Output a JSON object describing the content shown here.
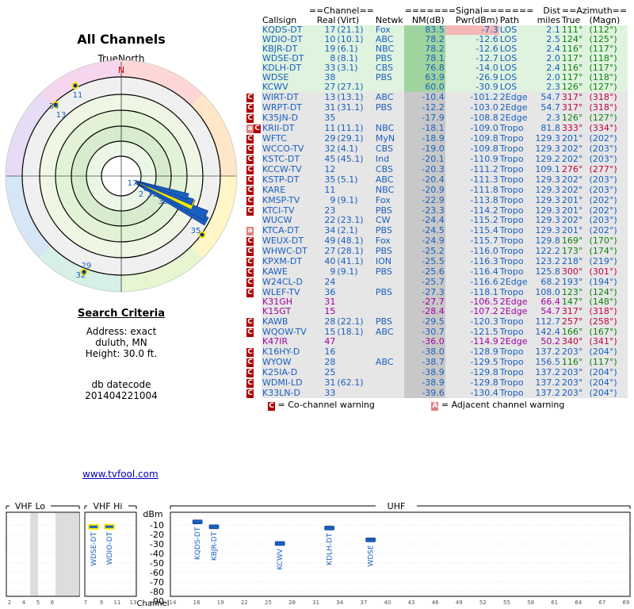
{
  "left": {
    "title": "All Channels",
    "truenorth": "TrueNorth",
    "north": "N",
    "plot_labels": [
      "11",
      "34",
      "13",
      "17",
      "8",
      "2",
      "33",
      "38",
      "35",
      "29",
      "32"
    ]
  },
  "criteria": {
    "heading": "Search Criteria",
    "address": "Address: exact",
    "city": "duluth, MN",
    "height": "Height: 30.0 ft."
  },
  "datecode": {
    "label": "db datecode",
    "value": "201404221004"
  },
  "link": "www.tvfool.com",
  "table": {
    "group_headers": {
      "channel": "==Channel==",
      "signal": "=======Signal=======",
      "dist": "Dist",
      "azimuth": "==Azimuth=="
    },
    "headers": [
      "Callsign",
      "Real",
      "(Virt)",
      "Netwk",
      "NM(dB)",
      "Pwr(dBm)",
      "Path",
      "miles",
      "True",
      "(Magn)"
    ],
    "rows": [
      {
        "w": "",
        "call": "KQDS-DT",
        "real": "17",
        "virt": "(21.1)",
        "net": "Fox",
        "nm": "83.5",
        "pwr": "-7.3",
        "path": "LOS",
        "dist": "2.1",
        "tru": "111°",
        "mag": "(112°)",
        "cls": "good",
        "pr": true
      },
      {
        "w": "",
        "call": "WDIO-DT",
        "real": "10",
        "virt": "(10.1)",
        "net": "ABC",
        "nm": "78.2",
        "pwr": "-12.6",
        "path": "LOS",
        "dist": "2.5",
        "tru": "124°",
        "mag": "(125°)",
        "cls": "good"
      },
      {
        "w": "",
        "call": "KBJR-DT",
        "real": "19",
        "virt": "(6.1)",
        "net": "NBC",
        "nm": "78.2",
        "pwr": "-12.6",
        "path": "LOS",
        "dist": "2.4",
        "tru": "116°",
        "mag": "(117°)",
        "cls": "good"
      },
      {
        "w": "",
        "call": "WDSE-DT",
        "real": "8",
        "virt": "(8.1)",
        "net": "PBS",
        "nm": "78.1",
        "pwr": "-12.7",
        "path": "LOS",
        "dist": "2.0",
        "tru": "117°",
        "mag": "(118°)",
        "cls": "good"
      },
      {
        "w": "",
        "call": "KDLH-DT",
        "real": "33",
        "virt": "(3.1)",
        "net": "CBS",
        "nm": "76.8",
        "pwr": "-14.0",
        "path": "LOS",
        "dist": "2.4",
        "tru": "116°",
        "mag": "(117°)",
        "cls": "good"
      },
      {
        "w": "",
        "call": "WDSE",
        "real": "38",
        "virt": "",
        "net": "PBS",
        "nm": "63.9",
        "pwr": "-26.9",
        "path": "LOS",
        "dist": "2.0",
        "tru": "117°",
        "mag": "(118°)",
        "cls": "good"
      },
      {
        "w": "",
        "call": "KCWV",
        "real": "27",
        "virt": "(27.1)",
        "net": "",
        "nm": "60.0",
        "pwr": "-30.9",
        "path": "LOS",
        "dist": "2.3",
        "tru": "126°",
        "mag": "(127°)",
        "cls": "good"
      },
      {
        "w": "C",
        "call": "WIRT-DT",
        "real": "13",
        "virt": "(13.1)",
        "net": "ABC",
        "nm": "-10.4",
        "pwr": "-101.2",
        "path": "2Edge",
        "dist": "54.7",
        "tru": "317°",
        "mag": "(318°)",
        "cls": "gray",
        "az": "red"
      },
      {
        "w": "C",
        "call": "WRPT-DT",
        "real": "31",
        "virt": "(31.1)",
        "net": "PBS",
        "nm": "-12.2",
        "pwr": "-103.0",
        "path": "2Edge",
        "dist": "54.7",
        "tru": "317°",
        "mag": "(318°)",
        "cls": "gray",
        "az": "red"
      },
      {
        "w": "C",
        "call": "K35JN-D",
        "real": "35",
        "virt": "",
        "net": "",
        "nm": "-17.9",
        "pwr": "-108.8",
        "path": "2Edge",
        "dist": "2.3",
        "tru": "126°",
        "mag": "(127°)",
        "cls": "gray",
        "az": "green"
      },
      {
        "w": "CA",
        "call": "KRII-DT",
        "real": "11",
        "virt": "(11.1)",
        "net": "NBC",
        "nm": "-18.1",
        "pwr": "-109.0",
        "path": "Tropo",
        "dist": "81.8",
        "tru": "333°",
        "mag": "(334°)",
        "cls": "gray",
        "az": "red"
      },
      {
        "w": "C",
        "call": "WFTC",
        "real": "29",
        "virt": "(29.1)",
        "net": "MyN",
        "nm": "-18.9",
        "pwr": "-109.8",
        "path": "Tropo",
        "dist": "129.3",
        "tru": "201°",
        "mag": "(202°)",
        "cls": "gray",
        "az": "blue"
      },
      {
        "w": "C",
        "call": "WCCO-TV",
        "real": "32",
        "virt": "(4.1)",
        "net": "CBS",
        "nm": "-19.0",
        "pwr": "-109.8",
        "path": "Tropo",
        "dist": "129.3",
        "tru": "202°",
        "mag": "(203°)",
        "cls": "gray",
        "az": "blue"
      },
      {
        "w": "C",
        "call": "KSTC-DT",
        "real": "45",
        "virt": "(45.1)",
        "net": "Ind",
        "nm": "-20.1",
        "pwr": "-110.9",
        "path": "Tropo",
        "dist": "129.2",
        "tru": "202°",
        "mag": "(203°)",
        "cls": "gray",
        "az": "blue"
      },
      {
        "w": "C",
        "call": "KCCW-TV",
        "real": "12",
        "virt": "",
        "net": "CBS",
        "nm": "-20.3",
        "pwr": "-111.2",
        "path": "Tropo",
        "dist": "109.1",
        "tru": "276°",
        "mag": "(277°)",
        "cls": "gray",
        "az": "red"
      },
      {
        "w": "C",
        "call": "KSTP-DT",
        "real": "35",
        "virt": "(5.1)",
        "net": "ABC",
        "nm": "-20.4",
        "pwr": "-111.3",
        "path": "Tropo",
        "dist": "129.3",
        "tru": "202°",
        "mag": "(203°)",
        "cls": "gray",
        "az": "blue"
      },
      {
        "w": "C",
        "call": "KARE",
        "real": "11",
        "virt": "",
        "net": "NBC",
        "nm": "-20.9",
        "pwr": "-111.8",
        "path": "Tropo",
        "dist": "129.3",
        "tru": "202°",
        "mag": "(203°)",
        "cls": "gray",
        "az": "blue"
      },
      {
        "w": "C",
        "call": "KMSP-TV",
        "real": "9",
        "virt": "(9.1)",
        "net": "Fox",
        "nm": "-22.9",
        "pwr": "-113.8",
        "path": "Tropo",
        "dist": "129.3",
        "tru": "201°",
        "mag": "(202°)",
        "cls": "gray",
        "az": "blue"
      },
      {
        "w": "C",
        "call": "KTCI-TV",
        "real": "23",
        "virt": "",
        "net": "PBS",
        "nm": "-23.3",
        "pwr": "-114.2",
        "path": "Tropo",
        "dist": "129.3",
        "tru": "201°",
        "mag": "(202°)",
        "cls": "gray",
        "az": "blue"
      },
      {
        "w": "",
        "call": "WUCW",
        "real": "22",
        "virt": "(23.1)",
        "net": "CW",
        "nm": "-24.4",
        "pwr": "-115.2",
        "path": "Tropo",
        "dist": "129.3",
        "tru": "202°",
        "mag": "(203°)",
        "cls": "gray",
        "az": "blue"
      },
      {
        "w": "A",
        "call": "KTCA-DT",
        "real": "34",
        "virt": "(2.1)",
        "net": "PBS",
        "nm": "-24.5",
        "pwr": "-115.4",
        "path": "Tropo",
        "dist": "129.3",
        "tru": "201°",
        "mag": "(202°)",
        "cls": "gray",
        "az": "blue"
      },
      {
        "w": "C",
        "call": "WEUX-DT",
        "real": "49",
        "virt": "(48.1)",
        "net": "Fox",
        "nm": "-24.9",
        "pwr": "-115.7",
        "path": "Tropo",
        "dist": "129.8",
        "tru": "169°",
        "mag": "(170°)",
        "cls": "gray",
        "az": "green"
      },
      {
        "w": "C",
        "call": "WHWC-DT",
        "real": "27",
        "virt": "(28.1)",
        "net": "PBS",
        "nm": "-25.2",
        "pwr": "-116.0",
        "path": "Tropo",
        "dist": "122.2",
        "tru": "173°",
        "mag": "(174°)",
        "cls": "gray",
        "az": "green"
      },
      {
        "w": "C",
        "call": "KPXM-DT",
        "real": "40",
        "virt": "(41.1)",
        "net": "ION",
        "nm": "-25.5",
        "pwr": "-116.3",
        "path": "Tropo",
        "dist": "123.2",
        "tru": "218°",
        "mag": "(219°)",
        "cls": "gray",
        "az": "blue"
      },
      {
        "w": "C",
        "call": "KAWE",
        "real": "9",
        "virt": "(9.1)",
        "net": "PBS",
        "nm": "-25.6",
        "pwr": "-116.4",
        "path": "Tropo",
        "dist": "125.8",
        "tru": "300°",
        "mag": "(301°)",
        "cls": "gray",
        "az": "red"
      },
      {
        "w": "C",
        "call": "W24CL-D",
        "real": "24",
        "virt": "",
        "net": "",
        "nm": "-25.7",
        "pwr": "-116.6",
        "path": "2Edge",
        "dist": "68.2",
        "tru": "193°",
        "mag": "(194°)",
        "cls": "gray",
        "az": "blue"
      },
      {
        "w": "C",
        "call": "WLEF-TV",
        "real": "36",
        "virt": "",
        "net": "PBS",
        "nm": "-27.3",
        "pwr": "-118.1",
        "path": "Tropo",
        "dist": "108.0",
        "tru": "123°",
        "mag": "(124°)",
        "cls": "gray",
        "az": "green"
      },
      {
        "w": "",
        "call": "K31GH",
        "real": "31",
        "virt": "",
        "net": "",
        "nm": "-27.7",
        "pwr": "-106.5",
        "path": "2Edge",
        "dist": "66.4",
        "tru": "147°",
        "mag": "(148°)",
        "cls": "gray",
        "az": "green",
        "purple": true
      },
      {
        "w": "",
        "call": "K15GT",
        "real": "15",
        "virt": "",
        "net": "",
        "nm": "-28.4",
        "pwr": "-107.2",
        "path": "2Edge",
        "dist": "54.7",
        "tru": "317°",
        "mag": "(318°)",
        "cls": "gray",
        "az": "red",
        "purple": true
      },
      {
        "w": "C",
        "call": "KAWB",
        "real": "28",
        "virt": "(22.1)",
        "net": "PBS",
        "nm": "-29.5",
        "pwr": "-120.3",
        "path": "Tropo",
        "dist": "112.7",
        "tru": "257°",
        "mag": "(258°)",
        "cls": "gray",
        "az": "red"
      },
      {
        "w": "C",
        "call": "WQOW-TV",
        "real": "15",
        "virt": "(18.1)",
        "net": "ABC",
        "nm": "-30.7",
        "pwr": "-121.5",
        "path": "Tropo",
        "dist": "142.4",
        "tru": "166°",
        "mag": "(167°)",
        "cls": "gray",
        "az": "green"
      },
      {
        "w": "",
        "call": "K47IR",
        "real": "47",
        "virt": "",
        "net": "",
        "nm": "-36.0",
        "pwr": "-114.9",
        "path": "2Edge",
        "dist": "50.2",
        "tru": "340°",
        "mag": "(341°)",
        "cls": "gray",
        "az": "red",
        "purple": true
      },
      {
        "w": "C",
        "call": "K16HY-D",
        "real": "16",
        "virt": "",
        "net": "",
        "nm": "-38.0",
        "pwr": "-128.9",
        "path": "Tropo",
        "dist": "137.2",
        "tru": "203°",
        "mag": "(204°)",
        "cls": "gray",
        "az": "blue"
      },
      {
        "w": "C",
        "call": "WYOW",
        "real": "28",
        "virt": "",
        "net": "ABC",
        "nm": "-38.7",
        "pwr": "-129.5",
        "path": "Tropo",
        "dist": "156.5",
        "tru": "116°",
        "mag": "(117°)",
        "cls": "gray",
        "az": "green"
      },
      {
        "w": "C",
        "call": "K25IA-D",
        "real": "25",
        "virt": "",
        "net": "",
        "nm": "-38.9",
        "pwr": "-129.8",
        "path": "Tropo",
        "dist": "137.2",
        "tru": "203°",
        "mag": "(204°)",
        "cls": "gray",
        "az": "blue"
      },
      {
        "w": "C",
        "call": "WDMI-LD",
        "real": "31",
        "virt": "(62.1)",
        "net": "",
        "nm": "-38.9",
        "pwr": "-129.8",
        "path": "Tropo",
        "dist": "137.2",
        "tru": "203°",
        "mag": "(204°)",
        "cls": "gray",
        "az": "blue"
      },
      {
        "w": "C",
        "call": "K33LN-D",
        "real": "33",
        "virt": "",
        "net": "",
        "nm": "-39.6",
        "pwr": "-130.4",
        "path": "Tropo",
        "dist": "137.2",
        "tru": "203°",
        "mag": "(204°)",
        "cls": "gray",
        "az": "blue"
      }
    ],
    "legend_co": "= Co-channel warning",
    "legend_adj": "= Adjacent channel warning",
    "co_mark": "C",
    "adj_mark": "A"
  },
  "spectrum": {
    "sections": {
      "vhf_lo": "VHF Lo",
      "vhf_hi": "VHF Hi",
      "dbm": "dBm",
      "uhf": "UHF"
    },
    "y_ticks": [
      "-10",
      "-20",
      "-30",
      "-40",
      "-50",
      "-60",
      "-70",
      "-80",
      "-90"
    ],
    "channel_label": "Channel",
    "lo_ticks": [
      "2",
      "4",
      "5",
      "6"
    ],
    "hi_ticks": [
      "7",
      "9",
      "11",
      "13"
    ],
    "uhf_ticks": [
      "14",
      "16",
      "19",
      "22",
      "25",
      "28",
      "31",
      "34",
      "37",
      "40",
      "43",
      "46",
      "49",
      "52",
      "55",
      "58",
      "61",
      "64",
      "67",
      "69"
    ],
    "stations": [
      {
        "label": "WDSE-DT",
        "band": "hi",
        "ch": 8,
        "dbm": -12.7
      },
      {
        "label": "WDIO-DT",
        "band": "hi",
        "ch": 10,
        "dbm": -12.6
      },
      {
        "label": "KQDS-DT",
        "band": "uhf",
        "ch": 17,
        "dbm": -7.3
      },
      {
        "label": "KBJR-DT",
        "band": "uhf",
        "ch": 19,
        "dbm": -12.6
      },
      {
        "label": "KCWV",
        "band": "uhf",
        "ch": 27,
        "dbm": -30.9
      },
      {
        "label": "KDLH-DT",
        "band": "uhf",
        "ch": 33,
        "dbm": -14.0
      },
      {
        "label": "WDSE",
        "band": "uhf",
        "ch": 38,
        "dbm": -26.9
      }
    ]
  }
}
